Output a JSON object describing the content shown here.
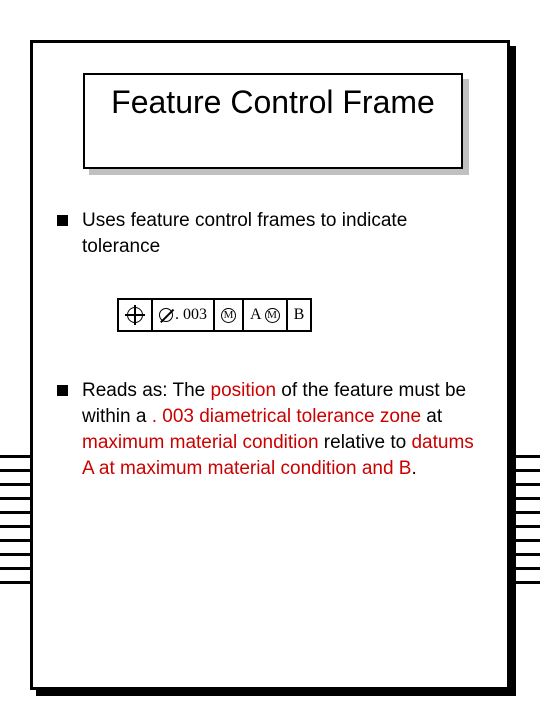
{
  "title": "Feature Control Frame",
  "bullets": {
    "b1": "Uses feature control frames to indicate tolerance",
    "b2_pre": "Reads as:  The ",
    "b2_h1": "position",
    "b2_s1": " of the feature must be within a ",
    "b2_h2": ". 003 diametrical tolerance zone",
    "b2_s2": " at ",
    "b2_h3": "maximum material condition",
    "b2_s3": " relative to ",
    "b2_h4": "datums A at maximum material condition and B",
    "b2_s4": "."
  },
  "fcf": {
    "tol_value": ". 003",
    "modifier_m": "M",
    "datum_a": "A",
    "datum_a_mod": "M",
    "datum_b": "B"
  },
  "stripes_top_px": "455"
}
